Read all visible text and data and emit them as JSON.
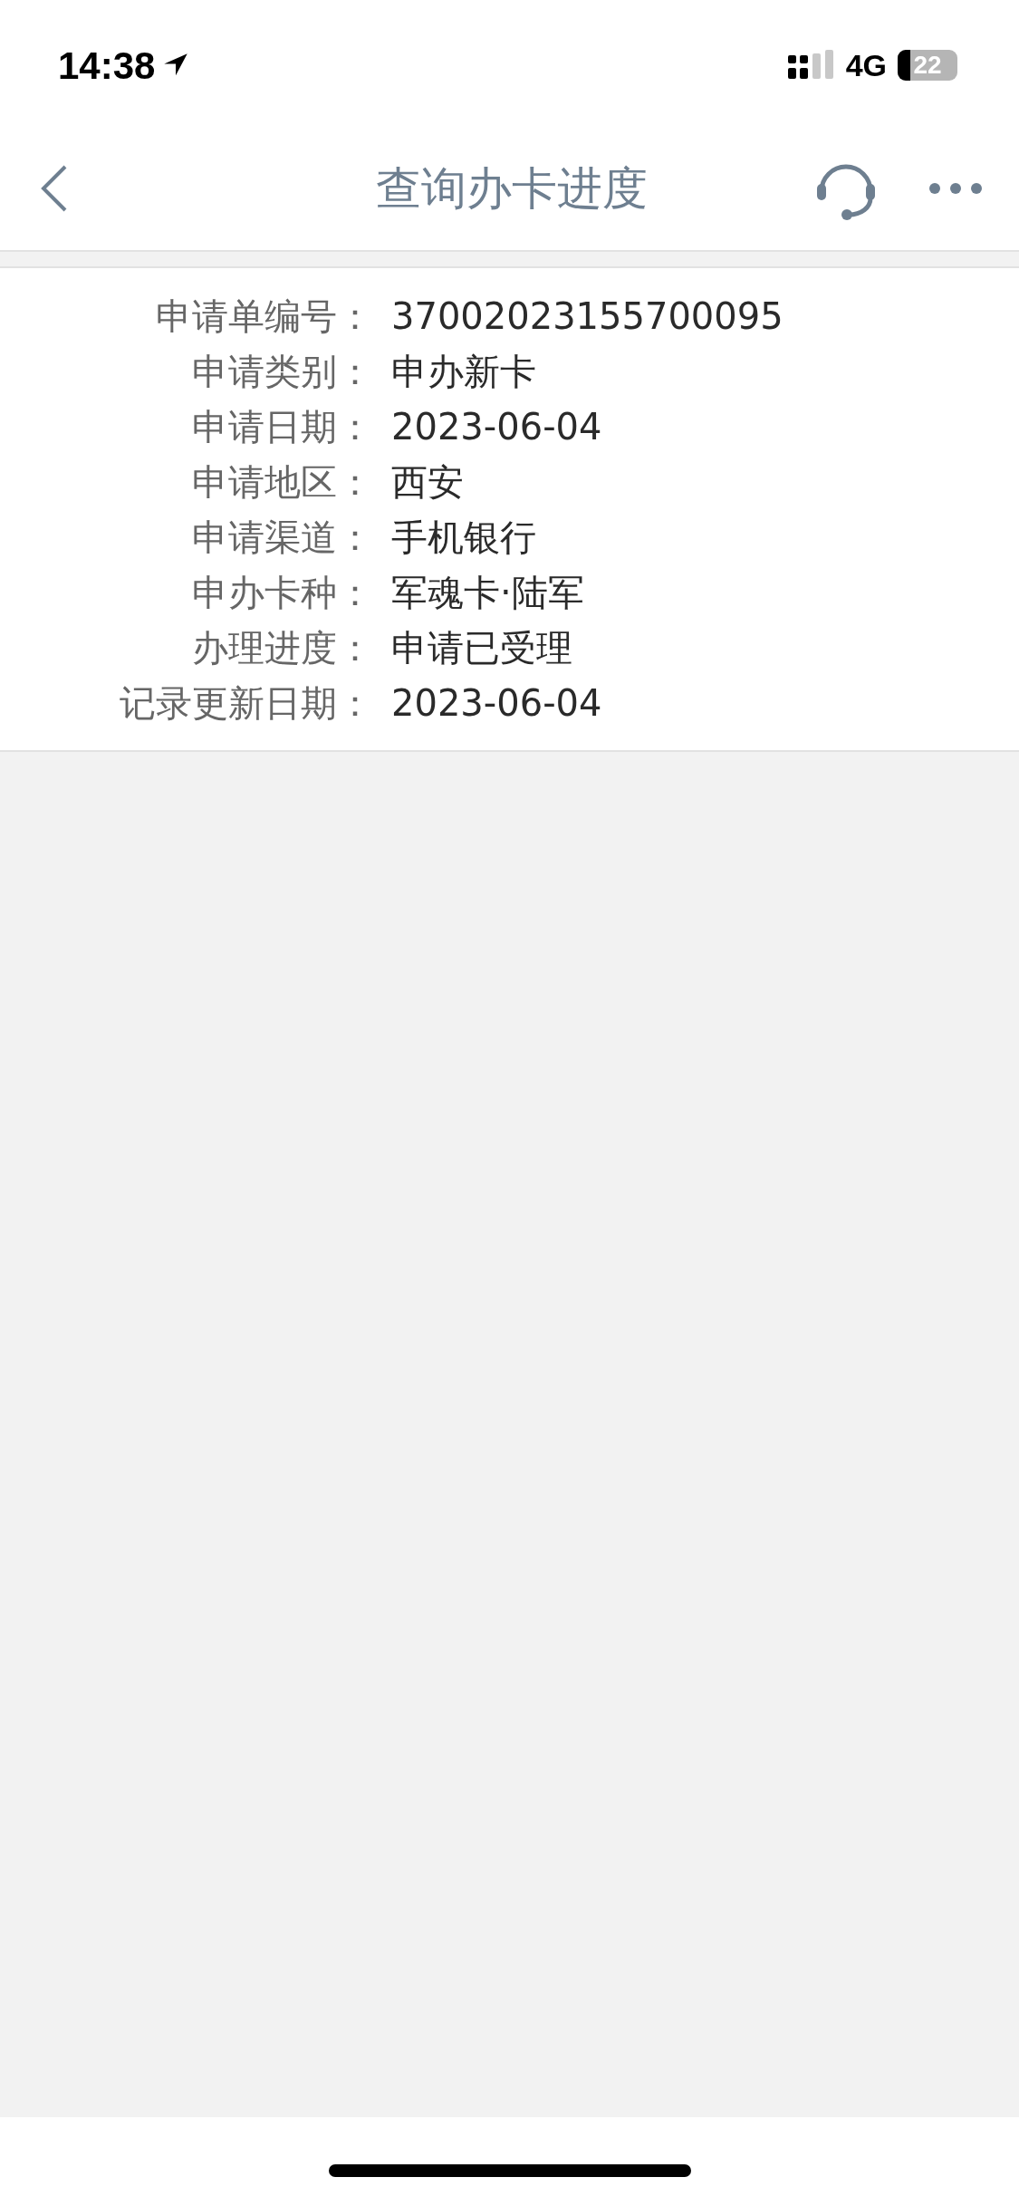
{
  "status_bar": {
    "time": "14:38",
    "network": "4G",
    "battery": "22"
  },
  "header": {
    "title": "查询办卡进度"
  },
  "details": [
    {
      "label": "申请单编号：",
      "value": "37002023155700095"
    },
    {
      "label": "申请类别：",
      "value": "申办新卡"
    },
    {
      "label": "申请日期：",
      "value": "2023-06-04"
    },
    {
      "label": "申请地区：",
      "value": "西安"
    },
    {
      "label": "申请渠道：",
      "value": "手机银行"
    },
    {
      "label": "申办卡种：",
      "value": "军魂卡·陆军"
    },
    {
      "label": "办理进度：",
      "value": "申请已受理"
    },
    {
      "label": "记录更新日期：",
      "value": "2023-06-04"
    }
  ]
}
